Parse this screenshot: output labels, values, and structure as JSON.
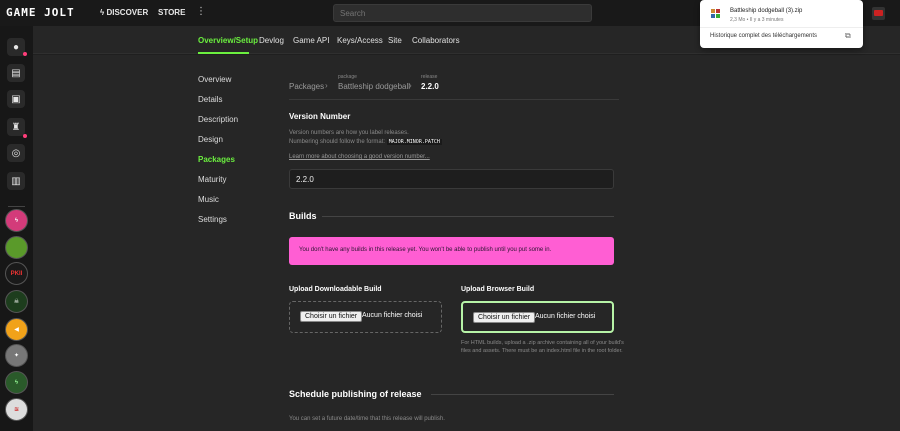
{
  "topbar": {
    "logo": "GAME JOLT",
    "nav": [
      {
        "id": "discover",
        "label": "DISCOVER",
        "icon": "flash-icon"
      },
      {
        "id": "store",
        "label": "STORE"
      }
    ],
    "search_placeholder": "Search"
  },
  "subnav": [
    {
      "id": "overview",
      "label": "Overview/Setup",
      "active": true
    },
    {
      "id": "devlog",
      "label": "Devlog"
    },
    {
      "id": "gameapi",
      "label": "Game API"
    },
    {
      "id": "keys",
      "label": "Keys/Access"
    },
    {
      "id": "site",
      "label": "Site"
    },
    {
      "id": "collaborators",
      "label": "Collaborators"
    }
  ],
  "left_menu": [
    {
      "label": "Overview"
    },
    {
      "label": "Details"
    },
    {
      "label": "Description"
    },
    {
      "label": "Design"
    },
    {
      "label": "Packages",
      "active": true
    },
    {
      "label": "Maturity"
    },
    {
      "label": "Music"
    },
    {
      "label": "Settings"
    }
  ],
  "breadcrumb": {
    "root": "Packages",
    "package_tag": "package",
    "package": "Battleship dodgeball",
    "release_tag": "release",
    "release": "2.2.0"
  },
  "version": {
    "heading": "Version Number",
    "help_line1": "Version numbers are how you label releases.",
    "help_line2": "Numbering should follow the format:",
    "format": "MAJOR.MINOR.PATCH",
    "learn_more": "Learn more about choosing a good version number...",
    "value": "2.2.0"
  },
  "builds": {
    "heading": "Builds",
    "alert": "You don't have any builds in this release yet. You won't be able to publish until you put some in.",
    "downloadable_label": "Upload Downloadable Build",
    "browser_label": "Upload Browser Build",
    "choose_file": "Choisir un fichier",
    "no_file": "Aucun fichier choisi",
    "browser_help": "For HTML builds, upload a .zip archive containing all of your build's files and assets. There must be an index.html file in the root folder."
  },
  "schedule": {
    "heading": "Schedule publishing of release",
    "help": "You can set a future date/time that this release will publish."
  },
  "download_popup": {
    "filename": "Battleship dodgeball (3).zip",
    "meta": "2,3 Mo • Il y a 3 minutes",
    "history": "Historique complet des téléchargements"
  },
  "colors": {
    "accent": "#6bef3f",
    "alert": "#ff5ed3",
    "background": "#262626"
  }
}
